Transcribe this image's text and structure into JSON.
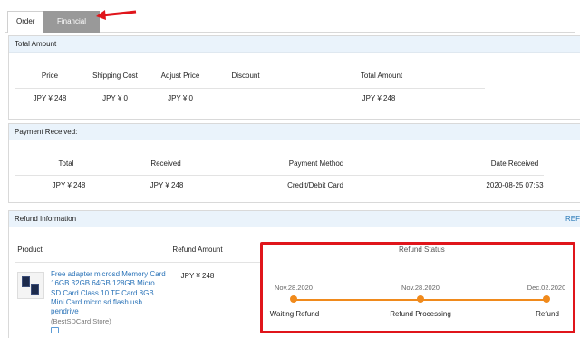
{
  "tabs": [
    {
      "label": "Order",
      "active": false
    },
    {
      "label": "Financial",
      "active": true
    }
  ],
  "total_amount": {
    "title": "Total Amount",
    "headers": [
      "Price",
      "Shipping Cost",
      "Adjust Price",
      "Discount",
      "Total Amount"
    ],
    "row": [
      "JPY ¥ 248",
      "JPY ¥ 0",
      "JPY ¥ 0",
      "",
      "JPY ¥ 248"
    ]
  },
  "payment_received": {
    "title": "Payment Received:",
    "headers": [
      "Total",
      "Received",
      "Payment Method",
      "Date Received"
    ],
    "row": [
      "JPY ¥ 248",
      "JPY ¥ 248",
      "Credit/Debit Card",
      "2020-08-25 07:53"
    ]
  },
  "refund": {
    "title": "Refund Information",
    "link": "REF",
    "headers": [
      "Product",
      "Refund Amount",
      "Refund Status"
    ],
    "product_title": "Free adapter microsd Memory Card 16GB 32GB 64GB 128GB Micro SD Card Class 10 TF Card 8GB Mini Card micro sd flash usb pendrive",
    "store": "(BestSDCard Store)",
    "amount": "JPY ¥ 248",
    "steps": [
      {
        "date": "Nov.28.2020",
        "label": "Waiting Refund"
      },
      {
        "date": "Nov.28.2020",
        "label": "Refund Processing"
      },
      {
        "date": "Dec.02.2020",
        "label": "Refund"
      }
    ]
  },
  "colors": {
    "accent": "#f08a1c",
    "highlight_box": "#e0151b",
    "link": "#2a73b8",
    "section_header_bg": "#eaf3fb",
    "active_tab": "#999999"
  }
}
